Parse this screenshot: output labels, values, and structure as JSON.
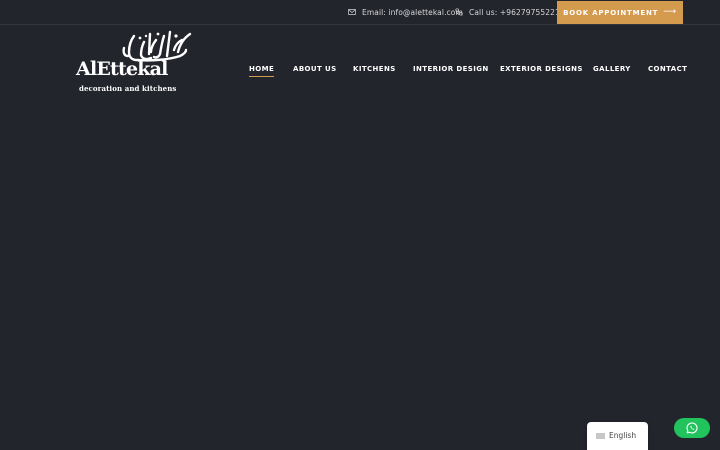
{
  "topbar": {
    "email_label": "Email: info@alettekal.com",
    "phone_label": "Call us: +962797552211",
    "book_label": "BOOK APPOINTMENT",
    "book_arrow": "⟶"
  },
  "logo": {
    "name": "AlEttekal",
    "tagline": "decoration and kitchens"
  },
  "nav": {
    "items": [
      {
        "label": "HOME",
        "active": true
      },
      {
        "label": "ABOUT US"
      },
      {
        "label": "KITCHENS"
      },
      {
        "label": "INTERIOR DESIGN"
      },
      {
        "label": "EXTERIOR DESIGNS"
      },
      {
        "label": "GALLERY"
      },
      {
        "label": "CONTACT"
      }
    ]
  },
  "language": {
    "label": "English"
  },
  "icons": {
    "email": "envelope-icon",
    "phone": "phone-icon",
    "whatsapp": "whatsapp-icon",
    "flag": "flag-icon"
  },
  "colors": {
    "background": "#23252d",
    "accent": "#d49a4e",
    "whatsapp": "#21c35c"
  }
}
